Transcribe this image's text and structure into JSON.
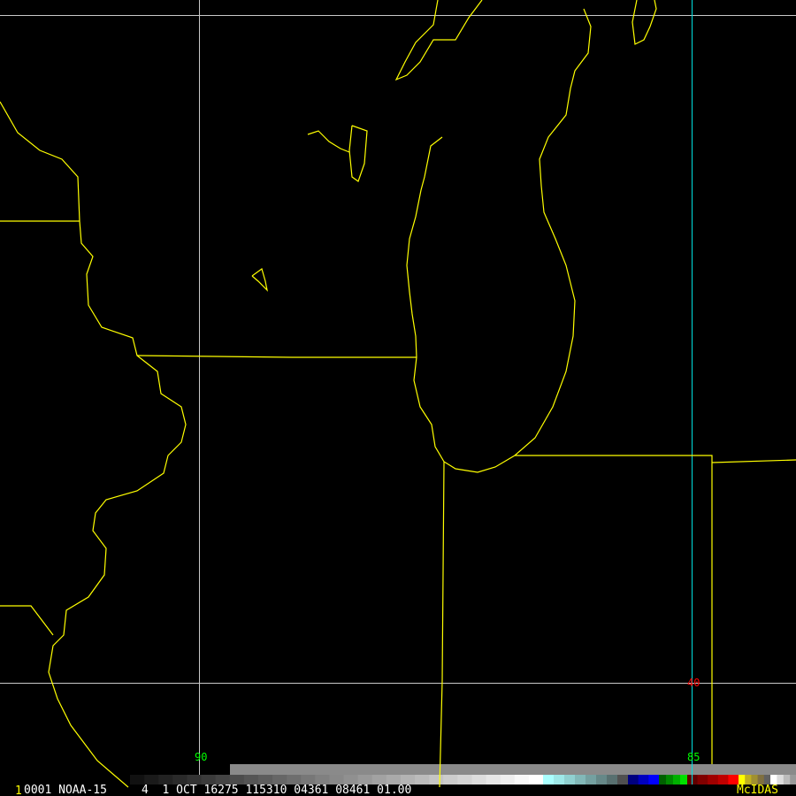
{
  "footer": {
    "frame_number": "1",
    "info": "0001 NOAA-15     4  1 OCT 16275 115310 04361 08461 01.00",
    "brand": "McIDAS"
  },
  "grid_labels": {
    "lon_90": "90",
    "lon_85": "85",
    "lat_40": "40"
  },
  "colors": {
    "boundary": "#ffff00",
    "grid": "#c8c8c8",
    "meridian_85": "#00e0e0",
    "lon_label": "#00ff00",
    "lat_label": "#ff0000",
    "brand": "#ffff00"
  },
  "color_bar": [
    [
      "#111",
      "#1a1a1a",
      "#222",
      "#2a2a2a",
      "#333",
      "#3b3b3b",
      "#444",
      "#4c4c4c",
      "#555",
      "#5d5d5d",
      "#666",
      "#6e6e6e",
      "#777",
      "#808080",
      "#888",
      "#909090",
      "#999",
      "#a2a2a2",
      "#aaa",
      "#b3b3b3",
      "#bbb",
      "#c4c4c4",
      "#ccc",
      "#d4d4d4",
      "#ddd",
      "#e6e6e6",
      "#eee",
      "#f8f8f8",
      "#fff"
    ],
    [
      "#aaffff",
      "#9ee8e8",
      "#90d0d0",
      "#82b8b8",
      "#74a0a0",
      "#668888",
      "#587070",
      "#505050"
    ],
    [
      "#000080",
      "#0000c0",
      "#0000ff"
    ],
    [
      "#006000",
      "#008800",
      "#00b000",
      "#00e000"
    ],
    [
      "#600000",
      "#800000",
      "#a00000",
      "#c00000",
      "#ff0000"
    ],
    [
      "#ffff00",
      "#c0b020",
      "#a09030",
      "#807040",
      "#606060"
    ],
    [
      "#ffffff",
      "#dddddd",
      "#bbbbbb",
      "#999999",
      "#808080"
    ],
    [
      "#000040"
    ]
  ]
}
